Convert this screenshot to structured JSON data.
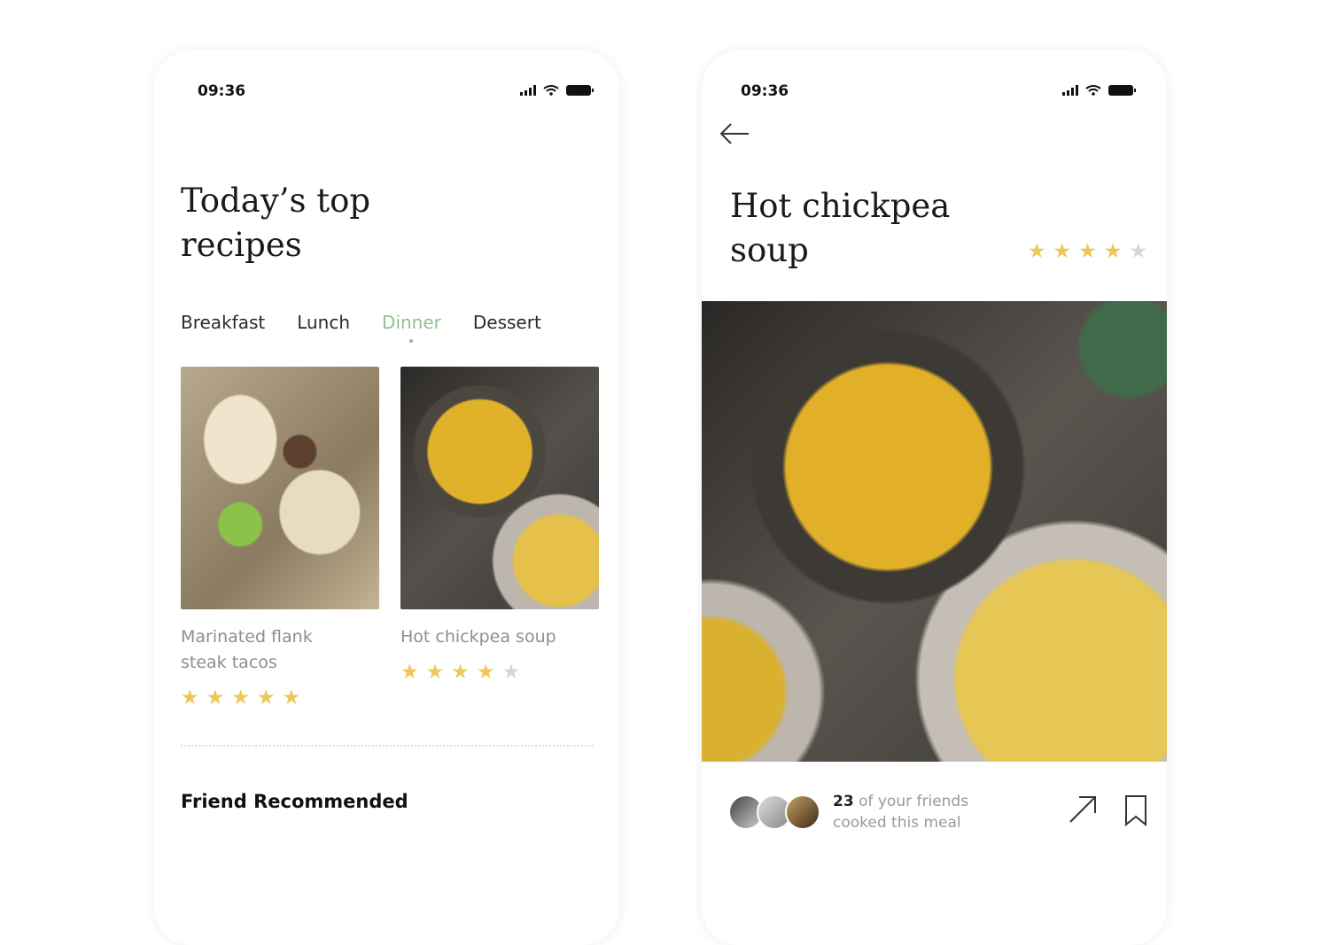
{
  "status_bar": {
    "time": "09:36"
  },
  "home": {
    "title_line1": "Today’s top",
    "title_line2": "recipes",
    "tabs": [
      {
        "label": "Breakfast"
      },
      {
        "label": "Lunch"
      },
      {
        "label": "Dinner",
        "active": true
      },
      {
        "label": "Dessert"
      }
    ],
    "cards": [
      {
        "title": "Marinated flank steak tacos",
        "rating": 5,
        "max_rating": 5
      },
      {
        "title": "Hot chickpea soup",
        "rating": 4,
        "max_rating": 5
      }
    ],
    "section_title": "Friend Recommended"
  },
  "detail": {
    "title_line1": "Hot chickpea",
    "title_line2": "soup",
    "rating": 4,
    "max_rating": 5,
    "friends_count": "23",
    "friends_text": " of your friends",
    "friends_text2": "cooked this meal"
  },
  "colors": {
    "star": "#ecc858",
    "star_off": "#d6d6d6",
    "active_tab": "#93bf95"
  },
  "icons": [
    "back-arrow-icon",
    "share-arrow-icon",
    "bookmark-icon",
    "signal-icon",
    "wifi-icon",
    "battery-icon",
    "star-icon"
  ]
}
